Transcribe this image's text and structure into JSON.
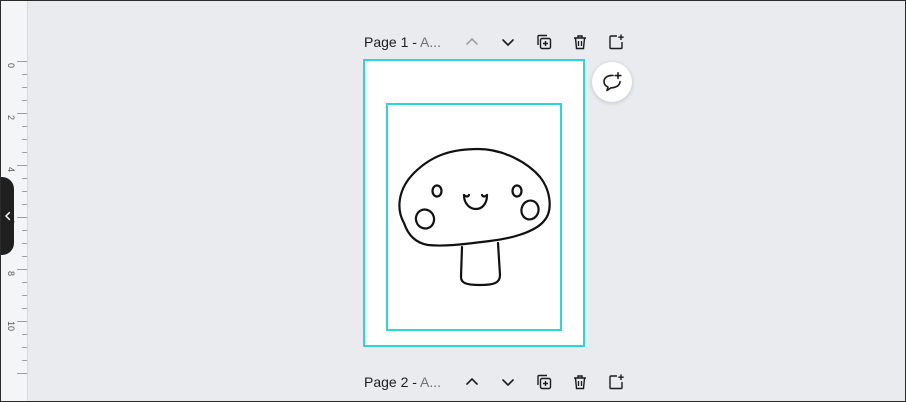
{
  "ruler": {
    "labels": [
      "0",
      "2",
      "4",
      "6",
      "8",
      "10"
    ]
  },
  "pages": [
    {
      "title": "Page 1 - ",
      "subtitle": "A..."
    },
    {
      "title": "Page 2 - ",
      "subtitle": "A..."
    }
  ],
  "icons": {
    "collapse": "chevron-left-icon",
    "move_up": "chevron-up-icon",
    "move_down": "chevron-down-icon",
    "duplicate": "duplicate-page-icon",
    "delete": "trash-icon",
    "add_page": "add-page-icon",
    "comment": "add-comment-icon"
  },
  "colors": {
    "selection": "#2ed4d9",
    "background": "#e9ebef"
  }
}
